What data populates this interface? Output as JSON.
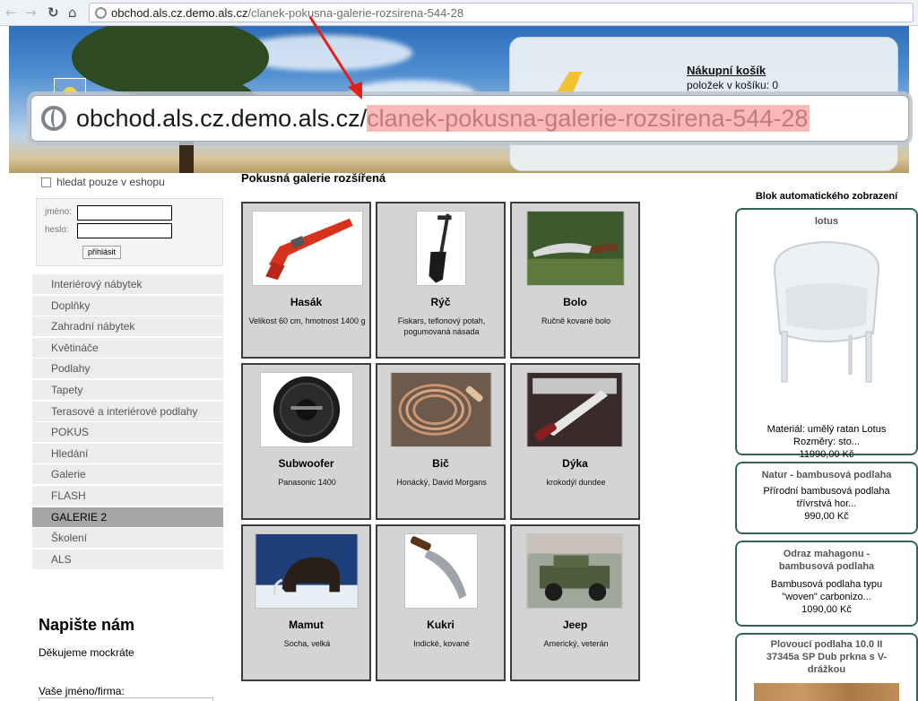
{
  "browser": {
    "url_host": "obchod.als.cz.demo.als.cz",
    "url_path": "/clanek-pokusna-galerie-rozsirena-544-28"
  },
  "zoom": {
    "url_host": "obchod.als.cz.demo.als.cz/",
    "url_path": "clanek-pokusna-galerie-rozsirena-544-28"
  },
  "header": {
    "cart_title": "Nákupní košík",
    "cart_count": "položek v košíku: 0"
  },
  "sidebar": {
    "search_only_label": "hledat pouze v eshopu",
    "login": {
      "name_label": "jméno:",
      "password_label": "heslo:",
      "submit_label": "přihlásit"
    },
    "menu": [
      {
        "label": "Interiérový nábytek"
      },
      {
        "label": "Doplňky"
      },
      {
        "label": "Zahradní nábytek"
      },
      {
        "label": "Květináče"
      },
      {
        "label": "Podlahy"
      },
      {
        "label": "Tapety"
      },
      {
        "label": "Terasové a interiérové podlahy"
      },
      {
        "label": "POKUS"
      },
      {
        "label": "Hledání"
      },
      {
        "label": "Galerie"
      },
      {
        "label": "FLASH"
      },
      {
        "label": "GALERIE 2",
        "active": true
      },
      {
        "label": "Školení"
      },
      {
        "label": "ALS"
      }
    ],
    "contact": {
      "title": "Napište nám",
      "thanks": "Děkujeme mockráte",
      "name_label": "Vaše jméno/firma:"
    }
  },
  "main": {
    "heading": "Pokusná galerie rozšířená",
    "gallery": [
      {
        "name": "Hasák",
        "desc": "Velikost 60 cm, hmotnost 1400 g",
        "image": "pipe-wrench"
      },
      {
        "name": "Rýč",
        "desc": "Fiskars, teflonový potah, pogumovaná násada",
        "image": "spade"
      },
      {
        "name": "Bolo",
        "desc": "Ručně kované bolo",
        "image": "bolo-knife"
      },
      {
        "name": "Subwoofer",
        "desc": "Panasonic 1400",
        "image": "subwoofer"
      },
      {
        "name": "Bič",
        "desc": "Honácký, David Morgans",
        "image": "whip"
      },
      {
        "name": "Dýka",
        "desc": "krokodýl dundee",
        "image": "dagger"
      },
      {
        "name": "Mamut",
        "desc": "Socha, velká",
        "image": "mammoth-sculpture"
      },
      {
        "name": "Kukri",
        "desc": "Indické, kované",
        "image": "kukri-knife"
      },
      {
        "name": "Jeep",
        "desc": "Americký, veterán",
        "image": "jeep"
      }
    ]
  },
  "right_sidebar": {
    "title": "Blok automatického zobrazení",
    "products": [
      {
        "name": "lotus",
        "desc_line1": "Materiál: umělý ratan Lotus",
        "desc_line2": "Rozměry: sto...",
        "price": "11990,00 Kč"
      },
      {
        "name": "Natur - bambusová podlaha",
        "desc_line1": "Přírodní bambusová podlaha",
        "desc_line2": "třívrstvá hor...",
        "price": "990,00 Kč"
      },
      {
        "name_line1": "Odraz mahagonu -",
        "name_line2": "bambusová podlaha",
        "desc_line1": "Bambusová podlaha typu",
        "desc_line2": "\"woven\" carbonizo...",
        "price": "1090,00 Kč"
      },
      {
        "name_line1": "Plovoucí podlaha 10.0 II",
        "name_line2": "37345a SP Dub prkna s V-",
        "name_line3": "drážkou"
      }
    ]
  },
  "colors": {
    "card_border": "#336650",
    "tile_background": "#d4d4d4",
    "menu_active": "#a6a6a6",
    "highlight": "#f9b9b9",
    "arrow": "#e0201a"
  },
  "icons": [
    "back-arrow-icon",
    "forward-arrow-icon",
    "reload-icon",
    "home-icon",
    "globe-icon",
    "checkbox-icon"
  ]
}
